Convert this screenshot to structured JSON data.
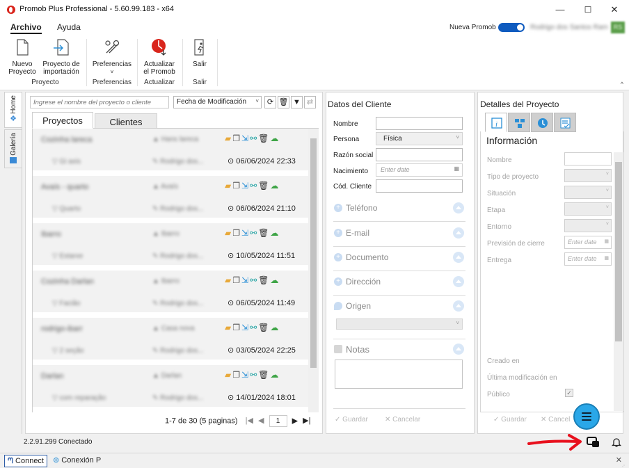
{
  "window": {
    "title": "Promob Plus Professional - 5.60.99.183 - x64",
    "min": "—",
    "max": "☐",
    "close": "✕"
  },
  "menu": {
    "archivo": "Archivo",
    "ayuda": "Ayuda",
    "nueva_promob": "Nueva Promob",
    "user_name": "Rodrigo dos Santos Ram",
    "user_initials": "RS"
  },
  "ribbon": {
    "nuevo": "Nuevo\nProyecto",
    "importacion": "Proyecto de\nimportación",
    "preferencias": "Preferencias",
    "actualizar": "Actualizar\nel Promob",
    "salir": "Salir",
    "groups": {
      "proyecto": "Proyecto",
      "preferencias": "Preferencias",
      "actualizar": "Actualizar",
      "salir": "Salir"
    }
  },
  "vtabs": {
    "home": "Home",
    "galeria": "Galería"
  },
  "projects": {
    "search_placeholder": "Ingrese el nombre del proyecto o cliente",
    "sort_value": "Fecha de Modificación",
    "tab_proyectos": "Proyectos",
    "tab_clientes": "Clientes",
    "items": [
      {
        "name": "Cozinha lareca",
        "owner": "Hans lareca",
        "sub": "Gi axis",
        "by": "Rodrigo dos...",
        "date": "06/06/2024 22:33"
      },
      {
        "name": "Avaís - quarto",
        "owner": "Avaís",
        "sub": "Quarto",
        "by": "Rodrigo dos...",
        "date": "06/06/2024 21:10"
      },
      {
        "name": "Ibarro",
        "owner": "Ibarro",
        "sub": "Estarxe",
        "by": "Rodrigo dos...",
        "date": "10/05/2024 11:51"
      },
      {
        "name": "Cozinha Darlan",
        "owner": "Ibarro",
        "sub": "Facião",
        "by": "Rodrigo dos...",
        "date": "06/05/2024 11:49"
      },
      {
        "name": "rodrigo-ibarr",
        "owner": "Casa nova",
        "sub": "2 seção",
        "by": "Rodrigo dos...",
        "date": "03/05/2024 22:25"
      },
      {
        "name": "Darlan",
        "owner": "Darlan",
        "sub": "com reparação",
        "by": "Rodrigo dos...",
        "date": "14/01/2024 18:01"
      }
    ],
    "pager_text": "1-7 de 30 (5 paginas)",
    "pager_page": "1"
  },
  "client": {
    "title": "Datos del Cliente",
    "labels": {
      "nombre": "Nombre",
      "persona": "Persona",
      "razon": "Razón social",
      "nacimiento": "Nacimiento",
      "cod": "Cód. Cliente"
    },
    "persona_value": "Física",
    "nacimiento_placeholder": "Enter date",
    "sections": {
      "telefono": "Teléfono",
      "email": "E-mail",
      "documento": "Documento",
      "direccion": "Dirección",
      "origen": "Origen",
      "notas": "Notas"
    },
    "guardar": "Guardar",
    "cancelar": "Cancelar"
  },
  "details": {
    "title": "Detalles del Proyecto",
    "info": "Información",
    "labels": {
      "nombre": "Nombre",
      "tipo": "Tipo de proyecto",
      "situacion": "Situación",
      "etapa": "Etapa",
      "entorno": "Entorno",
      "prevision": "Previsión de cierre",
      "entrega": "Entrega",
      "creado": "Creado en",
      "ultima": "Última modificación en",
      "publico": "Público"
    },
    "date_placeholder": "Enter date",
    "guardar": "Guardar",
    "cancelar": "Cancel"
  },
  "status": {
    "text": "2.2.91.299  Conectado"
  },
  "bottom": {
    "connect": "Connect",
    "conexion": "Conexión P"
  },
  "colors": {
    "accent": "#0f5bbf",
    "chat": "#2aa7e8",
    "arrow": "#e8101d",
    "promob_red": "#d9251c"
  }
}
